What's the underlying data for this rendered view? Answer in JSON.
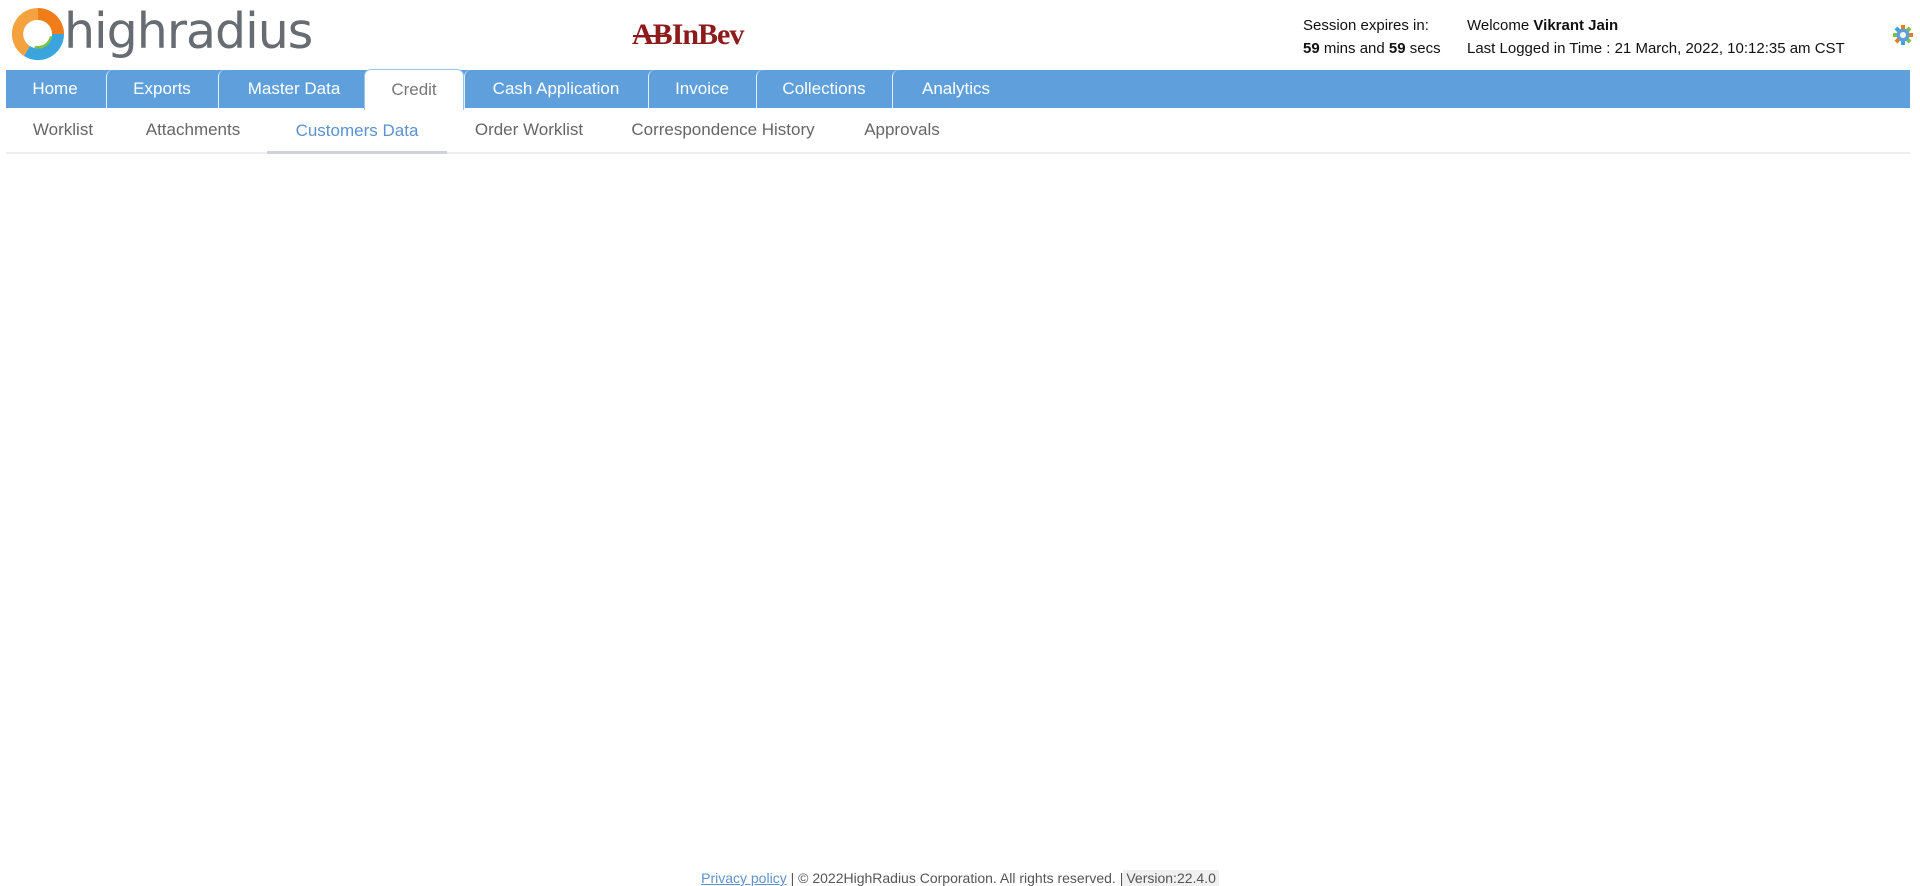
{
  "header": {
    "logo_text": "highradius",
    "brand_part1": "AB",
    "brand_part2": "InBev",
    "session": {
      "label": "Session expires in:",
      "minutes": "59",
      "mins_text": " mins and ",
      "seconds": "59",
      "secs_text": " secs"
    },
    "welcome": {
      "prefix": "Welcome ",
      "user": "Vikrant Jain",
      "last_login": "Last Logged in Time : 21 March, 2022, 10:12:35 am CST"
    },
    "settings_icon": "gear-icon"
  },
  "main_nav": {
    "tabs": [
      {
        "label": "Home"
      },
      {
        "label": "Exports"
      },
      {
        "label": "Master Data"
      },
      {
        "label": "Credit",
        "active": true
      },
      {
        "label": "Cash Application"
      },
      {
        "label": "Invoice"
      },
      {
        "label": "Collections"
      },
      {
        "label": "Analytics"
      }
    ]
  },
  "sub_nav": {
    "tabs": [
      {
        "label": "Worklist"
      },
      {
        "label": "Attachments"
      },
      {
        "label": "Customers Data",
        "active": true
      },
      {
        "label": "Order Worklist"
      },
      {
        "label": "Correspondence History"
      },
      {
        "label": "Approvals"
      }
    ]
  },
  "footer": {
    "privacy": "Privacy policy",
    "separator": " | ",
    "copyright": "© 2022HighRadius Corporation. All rights reserved. |",
    "version": "Version:22.4.0"
  },
  "colors": {
    "nav_blue": "#5fa0dc",
    "active_subtab": "#5b92cf",
    "brand_red": "#8d1b1b",
    "logo_orange": "#f07d1a",
    "logo_blue": "#3aa5dd",
    "logo_green": "#7cc242"
  }
}
